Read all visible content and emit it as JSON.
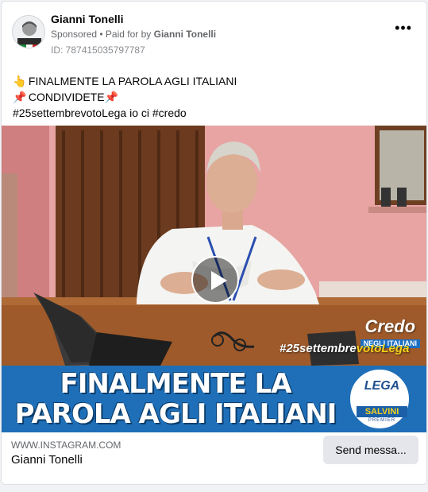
{
  "post": {
    "author": "Gianni Tonelli",
    "sponsored": "Sponsored",
    "paid_prefix": "• Paid for by",
    "paid_by": "Gianni Tonelli",
    "ad_id": "ID: 787415035797787",
    "more_label": "•••"
  },
  "caption": {
    "line1_emoji": "👆",
    "line1": "FINALMENTE LA PAROLA AGLI ITALIANI",
    "line2_emoji": "📌",
    "line2": "CONDIVIDETE",
    "line2_emoji_end": "📌",
    "line3": "#25settembrevotoLega io ci #credo"
  },
  "video": {
    "credo": "Credo",
    "credo_sub": "NEGLI ITALIANI",
    "hashtag_white": "#25settembre",
    "hashtag_yellow": "votoLega",
    "banner_line1": "FINALMENTE LA",
    "banner_line2": "PAROLA AGLI ITALIANI",
    "logo_name": "LEGA",
    "logo_salvini": "SALVINI",
    "logo_premier": "PREMIER",
    "colors": {
      "banner": "#1f6fb8",
      "accent": "#f5d21a",
      "wall": "#d9888c"
    }
  },
  "footer": {
    "domain": "WWW.INSTAGRAM.COM",
    "page_name": "Gianni Tonelli",
    "cta": "Send messa..."
  }
}
